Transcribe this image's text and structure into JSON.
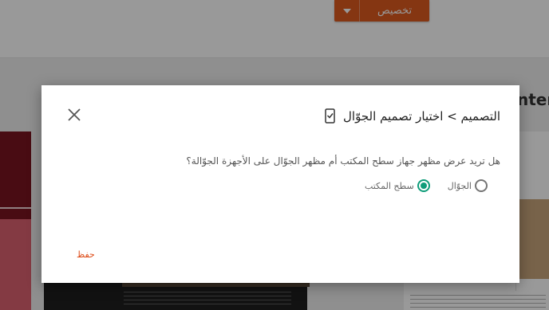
{
  "toolbar": {
    "customize_label": "تخصيص",
    "accent_color": "#de5a1e"
  },
  "canvas": {
    "partial_heading": "nter"
  },
  "dialog": {
    "title": "التصميم > اختيار تصميم الجوّال",
    "question": "هل تريد عرض مظهر جهاز سطح المكتب أم مظهر الجوّال على الأجهزة الجوّالة؟",
    "options": [
      {
        "label": "الجوّال",
        "selected": false
      },
      {
        "label": "سطح المكتب",
        "selected": true
      }
    ],
    "save_label": "حفظ",
    "radio_color": "#0f9d7a",
    "icons": {
      "title_icon": "mobile-phone-check-icon",
      "close_icon": "close-icon"
    }
  }
}
